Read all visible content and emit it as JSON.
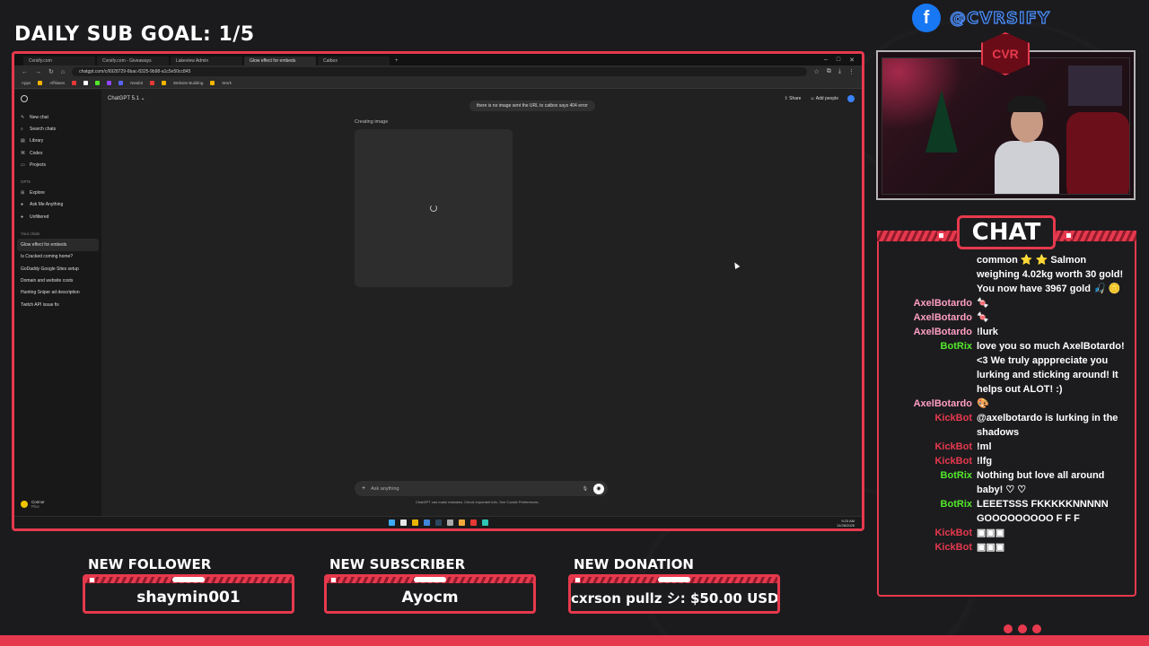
{
  "overlay": {
    "goal_text": "DAILY SUB GOAL: 1/5",
    "social_handle": "@CVRSIFY",
    "social_icon": "facebook-icon",
    "logo_text": "CVR",
    "accent_color": "#e6394d"
  },
  "browser": {
    "tabs": [
      {
        "label": "Cvrsify.com"
      },
      {
        "label": "Cvrsify.com - Giveaways"
      },
      {
        "label": "Lakeview Admin"
      },
      {
        "label": "Glow effect for embeds",
        "active": true
      },
      {
        "label": "Catbox"
      }
    ],
    "url": "chatgpt.com/c/6928729-6bac-8325-9b98-a1c5e50cc845",
    "bookmarks": [
      "Apps",
      "Affiliates",
      "Newbit",
      "Website Building",
      "Work"
    ]
  },
  "chatgpt": {
    "model": "ChatGPT 5.1",
    "user_message": "there is no image sent the URL to catbox says 404 error",
    "share_label": "Share",
    "add_people_label": "Add people",
    "creating_label": "Creating image",
    "composer_placeholder": "Ask anything",
    "disclaimer": "ChatGPT can make mistakes. Check important info. See Cookie Preferences.",
    "sidebar": {
      "items": [
        {
          "label": "New chat",
          "icon": "pencil-icon"
        },
        {
          "label": "Search chats",
          "icon": "search-icon"
        },
        {
          "label": "Library",
          "icon": "library-icon"
        },
        {
          "label": "Codex",
          "icon": "code-icon"
        },
        {
          "label": "Projects",
          "icon": "folder-icon"
        }
      ],
      "gpts_heading": "GPTs",
      "gpts": [
        {
          "label": "Explore",
          "icon": "grid-icon"
        },
        {
          "label": "Ask Me Anything",
          "icon": "gpt-icon"
        },
        {
          "label": "Unfiltered",
          "icon": "gpt-icon"
        }
      ],
      "chats_heading": "Your chats",
      "chats": [
        "Glow effect for embeds",
        "Is Cracked coming home?",
        "GoDaddy Google Sites setup",
        "Domain and website costs",
        "Hunting Sniper ad description",
        "Twitch API issue fix"
      ],
      "user_name": "Connor",
      "user_plan": "Plus"
    },
    "tray_time": "9:23 AM",
    "tray_date": "11/28/2025"
  },
  "chat": {
    "title": "CHAT",
    "messages": [
      {
        "user": "",
        "color": "#ffffff",
        "text": "common ⭐ ⭐ Salmon weighing 4.02kg worth 30 gold! You now have 3967 gold 🎣 🪙"
      },
      {
        "user": "AxelBotardo",
        "color": "#ff9ec1",
        "text": "🍬"
      },
      {
        "user": "AxelBotardo",
        "color": "#ff9ec1",
        "text": "🍬"
      },
      {
        "user": "AxelBotardo",
        "color": "#ff9ec1",
        "text": "!lurk"
      },
      {
        "user": "BotRix",
        "color": "#53e82b",
        "text": "love you so much AxelBotardo! <3 We truly apppreciate you lurking and sticking around! It helps out ALOT! :)"
      },
      {
        "user": "AxelBotardo",
        "color": "#ff9ec1",
        "text": "🎨"
      },
      {
        "user": "KickBot",
        "color": "#e6394d",
        "text": "@axelbotardo is lurking in the shadows"
      },
      {
        "user": "KickBot",
        "color": "#e6394d",
        "text": "!ml"
      },
      {
        "user": "KickBot",
        "color": "#e6394d",
        "text": "!lfg"
      },
      {
        "user": "BotRix",
        "color": "#53e82b",
        "text": "Nothing but love all around baby! ♡ ♡"
      },
      {
        "user": "BotRix",
        "color": "#53e82b",
        "text": "LEEETSSS FKKKKKNNNNN GOOOOOOOOO F F F"
      },
      {
        "user": "KickBot",
        "color": "#e6394d",
        "text": "▣▣▣"
      },
      {
        "user": "KickBot",
        "color": "#e6394d",
        "text": "▣▣▣"
      }
    ]
  },
  "alerts": {
    "follower": {
      "label": "NEW FOLLOWER",
      "value": "shaymin001"
    },
    "subscriber": {
      "label": "NEW SUBSCRIBER",
      "value": "Ayocm"
    },
    "donation": {
      "label": "NEW DONATION",
      "value": "cxrson pullz シ: $50.00 USD"
    }
  }
}
